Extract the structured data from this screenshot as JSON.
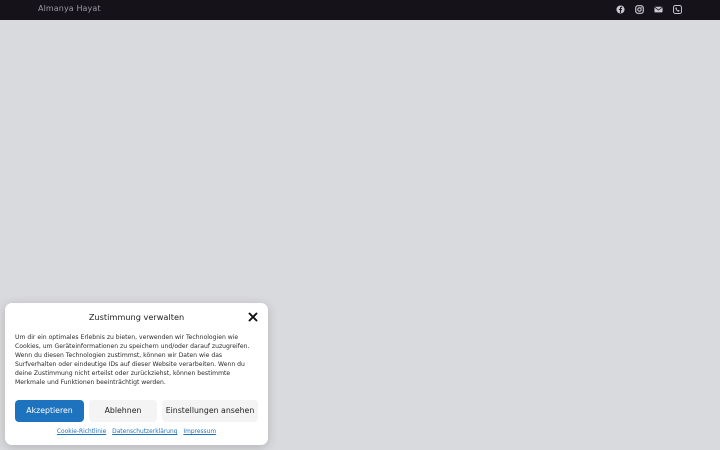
{
  "header": {
    "brand": "Almanya Hayat",
    "social_icons": [
      "facebook-icon",
      "instagram-icon",
      "mail-icon",
      "phone-icon"
    ]
  },
  "consent": {
    "title": "Zustimmung verwalten",
    "text": "Um dir ein optimales Erlebnis zu bieten, verwenden wir Technologien wie Cookies, um Geräteinformationen zu speichern und/oder darauf zuzugreifen. Wenn du diesen Technologien zustimmst, können wir Daten wie das Surfverhalten oder eindeutige IDs auf dieser Website verarbeiten. Wenn du deine Zustimmung nicht erteilst oder zurückziehst, können bestimmte Merkmale und Funktionen beeinträchtigt werden.",
    "accept_label": "Akzeptieren",
    "deny_label": "Ablehnen",
    "settings_label": "Einstellungen ansehen",
    "links": {
      "cookie_policy": "Cookie-Richtlinie",
      "privacy": "Datenschutzerklärung",
      "imprint": "Impressum"
    }
  },
  "colors": {
    "topbar": "#16121a",
    "page_background": "#d9dadd",
    "accent": "#1e73be"
  }
}
